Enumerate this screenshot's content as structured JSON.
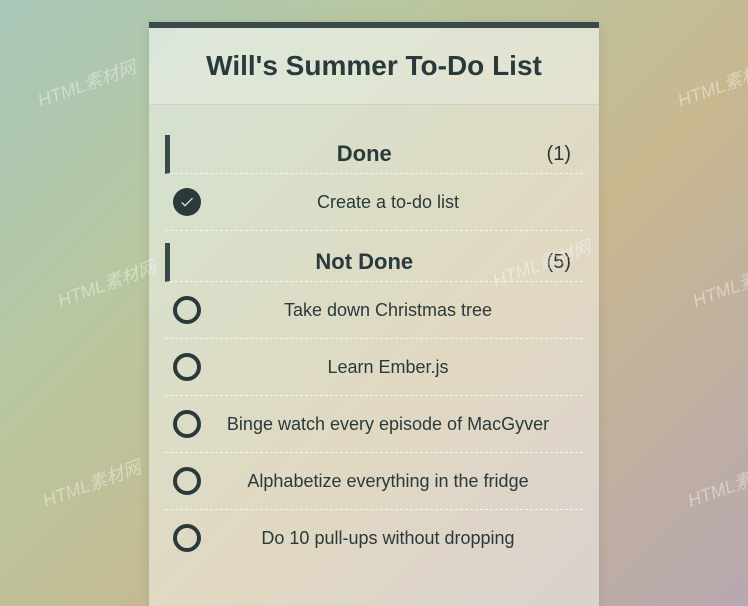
{
  "title": "Will's Summer To-Do List",
  "sections": [
    {
      "title": "Done",
      "count": "(1)",
      "items": [
        {
          "label": "Create a to-do list",
          "done": true
        }
      ]
    },
    {
      "title": "Not Done",
      "count": "(5)",
      "items": [
        {
          "label": "Take down Christmas tree",
          "done": false
        },
        {
          "label": "Learn Ember.js",
          "done": false
        },
        {
          "label": "Binge watch every episode of MacGyver",
          "done": false
        },
        {
          "label": "Alphabetize everything in the fridge",
          "done": false
        },
        {
          "label": "Do 10 pull-ups without dropping",
          "done": false
        }
      ]
    }
  ],
  "watermark": "HTML素材网"
}
